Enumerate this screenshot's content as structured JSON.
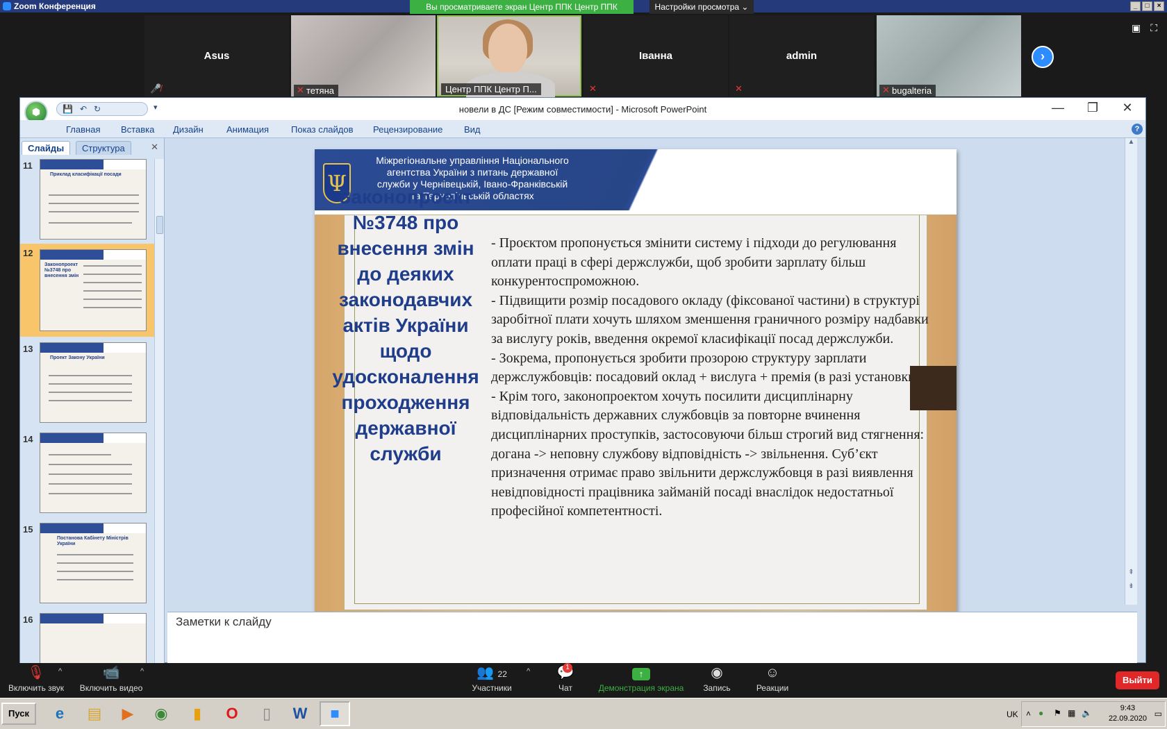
{
  "zoom": {
    "window_title": "Zoom Конференция",
    "share_banner": "Вы просматриваете экран Центр ППК Центр ППК",
    "view_options": "Настройки просмотра",
    "participants": [
      {
        "name": "Asus"
      },
      {
        "name": "тетяна"
      },
      {
        "name": "Центр ППК Центр П..."
      },
      {
        "name": "Іванна"
      },
      {
        "name": "admin"
      },
      {
        "name": "bugalteria"
      }
    ],
    "controls": {
      "audio": "Включить звук",
      "video": "Включить видео",
      "participants_label": "Участники",
      "participants_count": "22",
      "chat": "Чат",
      "chat_badge": "1",
      "share": "Демонстрация экрана",
      "record": "Запись",
      "reactions": "Реакции",
      "leave": "Выйти"
    }
  },
  "ppt": {
    "title": "новели в ДС [Режим совместимости] - Microsoft PowerPoint",
    "ribbon_tabs": [
      "Главная",
      "Вставка",
      "Дизайн",
      "Анимация",
      "Показ слайдов",
      "Рецензирование",
      "Вид"
    ],
    "pane_tabs": {
      "slides": "Слайды",
      "outline": "Структура"
    },
    "thumbnails": [
      {
        "num": "11",
        "title": "Приклад класифікації посади"
      },
      {
        "num": "12",
        "title": "Законопроект №3748 про внесення змін"
      },
      {
        "num": "13",
        "title": "Проект Закону України"
      },
      {
        "num": "14",
        "title": ""
      },
      {
        "num": "15",
        "title": "Постанова Кабінету Міністрів України"
      },
      {
        "num": "16",
        "title": ""
      }
    ],
    "notes_placeholder": "Заметки к слайду",
    "slide": {
      "org_lines": [
        "Міжрегіональне управління Національного",
        "агентства України з питань державної",
        "служби  у Чернівецькій, Івано-Франківській",
        "та Тернопільській областях"
      ],
      "heading": "Законопроект №3748 про внесення змін до деяких законодавчих актів України щодо удосконалення проходження державної служби",
      "paragraphs": [
        "- Проєктом пропонується змінити систему і підходи до регулювання оплати праці в сфері держслужби, щоб зробити зарплату більш конкурентоспроможною.",
        "- Підвищити розмір посадового окладу (фіксованої частини) в структурі заробітної плати хочуть шляхом зменшення граничного розміру надбавки за вислугу років, введення окремої класифікації посад держслужби.",
        "- Зокрема, пропонується зробити прозорою структуру зарплати держслужбовців: посадовий оклад + вислуга + премія (в разі установки).",
        "- Крім того, законопроектом хочуть посилити дисциплінарну відповідальність державних службовців за повторне вчинення дисциплінарних проступків, застосовуючи більш строгий вид стягнення: догана -> неповну службову відповідність -> звільнення. Суб’єкт призначення отримає право звільнити держслужбовця в разі виявлення невідповідності працівника займаній посаді внаслідок недостатньої професійної компетентності."
      ]
    }
  },
  "taskbar": {
    "start": "Пуск",
    "lang": "UK",
    "time": "9:43",
    "date": "22.09.2020"
  }
}
